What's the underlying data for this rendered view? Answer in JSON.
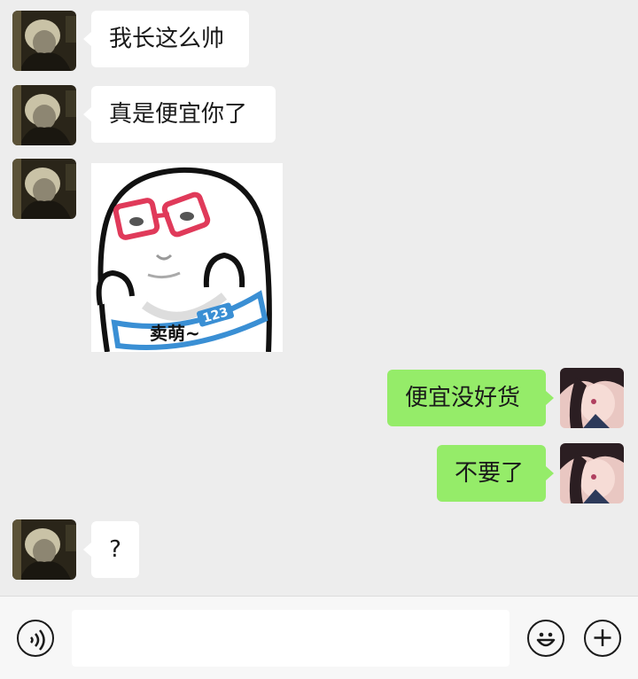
{
  "messages": [
    {
      "side": "in",
      "type": "text",
      "text": "我长这么帅"
    },
    {
      "side": "in",
      "type": "text",
      "text": "真是便宜你了"
    },
    {
      "side": "in",
      "type": "sticker",
      "caption": "卖萌~",
      "band_text": "123"
    },
    {
      "side": "out",
      "type": "text",
      "text": "便宜没好货"
    },
    {
      "side": "out",
      "type": "text",
      "text": "不要了"
    },
    {
      "side": "in",
      "type": "text",
      "text": "?"
    }
  ],
  "input_bar": {
    "voice_icon": "voice-icon",
    "message_placeholder": "",
    "emoji_icon": "emoji-icon",
    "plus_icon": "plus-icon"
  },
  "colors": {
    "background": "#ededed",
    "incoming_bubble": "#ffffff",
    "outgoing_bubble": "#95ec69"
  }
}
